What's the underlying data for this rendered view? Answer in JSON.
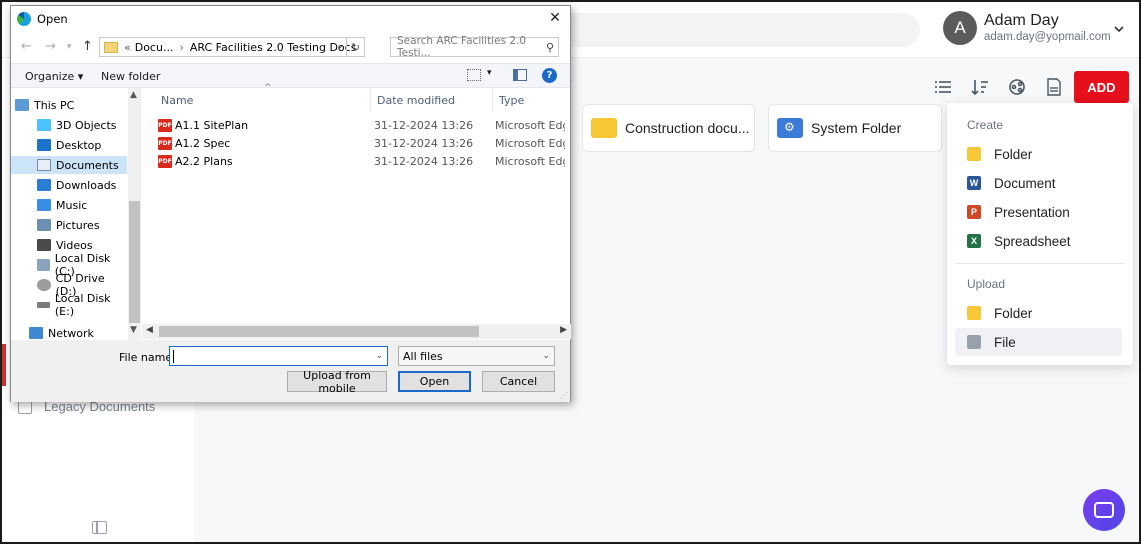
{
  "header": {
    "user_initial": "A",
    "user_name": "Adam Day",
    "user_email": "adam.day@yopmail.com"
  },
  "sidebar": {
    "legacy_label": "Legacy Documents"
  },
  "toolbar": {
    "add_label": "ADD"
  },
  "tiles": [
    {
      "label": "Construction docu..."
    },
    {
      "label": "System Folder"
    }
  ],
  "add_menu": {
    "create_heading": "Create",
    "create_items": [
      {
        "label": "Folder",
        "icon": "folder-icon"
      },
      {
        "label": "Document",
        "icon": "word-icon"
      },
      {
        "label": "Presentation",
        "icon": "powerpoint-icon"
      },
      {
        "label": "Spreadsheet",
        "icon": "excel-icon"
      }
    ],
    "upload_heading": "Upload",
    "upload_items": [
      {
        "label": "Folder",
        "icon": "folder-upload-icon"
      },
      {
        "label": "File",
        "icon": "file-upload-icon"
      }
    ]
  },
  "dialog": {
    "title": "Open",
    "close_glyph": "✕",
    "breadcrumb": [
      "«",
      "Docu...",
      "ARC Facilities 2.0 Testing Docs"
    ],
    "search_placeholder": "Search ARC Facilities 2.0 Testi...",
    "organize_label": "Organize ▾",
    "new_folder_label": "New folder",
    "nav_items": [
      {
        "label": "This PC",
        "icon": "pc-icon"
      },
      {
        "label": "3D Objects",
        "icon": "3d-objects-icon"
      },
      {
        "label": "Desktop",
        "icon": "desktop-icon"
      },
      {
        "label": "Documents",
        "icon": "documents-icon",
        "selected": true
      },
      {
        "label": "Downloads",
        "icon": "downloads-icon"
      },
      {
        "label": "Music",
        "icon": "music-icon"
      },
      {
        "label": "Pictures",
        "icon": "pictures-icon"
      },
      {
        "label": "Videos",
        "icon": "videos-icon"
      },
      {
        "label": "Local Disk (C:)",
        "icon": "disk-icon"
      },
      {
        "label": "CD Drive (D:)",
        "icon": "cd-drive-icon"
      },
      {
        "label": "Local Disk (E:)",
        "icon": "disk-icon"
      },
      {
        "label": "Network",
        "icon": "network-icon"
      }
    ],
    "columns": [
      "Name",
      "Date modified",
      "Type"
    ],
    "files": [
      {
        "name": "A1.1 SitePlan",
        "date": "31-12-2024 13:26",
        "type": "Microsoft Edge PDF Document"
      },
      {
        "name": "A1.2 Spec",
        "date": "31-12-2024 13:26",
        "type": "Microsoft Edge PDF Document"
      },
      {
        "name": "A2.2 Plans",
        "date": "31-12-2024 13:26",
        "type": "Microsoft Edge PDF Document"
      }
    ],
    "file_name_label": "File name:",
    "file_name_value": "",
    "filter_value": "All files",
    "upload_mobile_label": "Upload from mobile",
    "open_label": "Open",
    "cancel_label": "Cancel"
  }
}
